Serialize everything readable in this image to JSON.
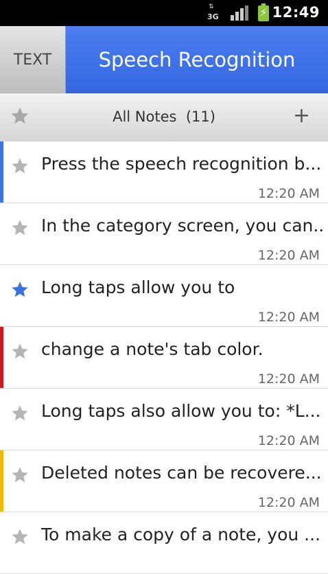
{
  "status_bar": {
    "network_type": "3G",
    "time": "12:49"
  },
  "title_bar": {
    "text_tab_label": "TEXT",
    "title": "Speech Recognition",
    "accent_color": "#3f72e8"
  },
  "notes_header": {
    "label": "All Notes",
    "count": "(11)",
    "add_label": "+"
  },
  "notes": [
    {
      "text": "Press the speech recognition b...",
      "time": "12:20 AM",
      "starred": false,
      "tab_color": "#3f72e8"
    },
    {
      "text": "In the category screen, you can...",
      "time": "12:20 AM",
      "starred": false,
      "tab_color": ""
    },
    {
      "text": "Long taps allow you to",
      "time": "12:20 AM",
      "starred": true,
      "tab_color": ""
    },
    {
      "text": "change a note's tab color.",
      "time": "12:20 AM",
      "starred": false,
      "tab_color": "#d0181c"
    },
    {
      "text": "Long taps also allow you to:  *L...",
      "time": "12:20 AM",
      "starred": false,
      "tab_color": ""
    },
    {
      "text": "Deleted notes can be recovere...",
      "time": "12:20 AM",
      "starred": false,
      "tab_color": "#f0b800"
    },
    {
      "text": "To make a copy of a note, you ...",
      "time": "",
      "starred": false,
      "tab_color": ""
    }
  ]
}
